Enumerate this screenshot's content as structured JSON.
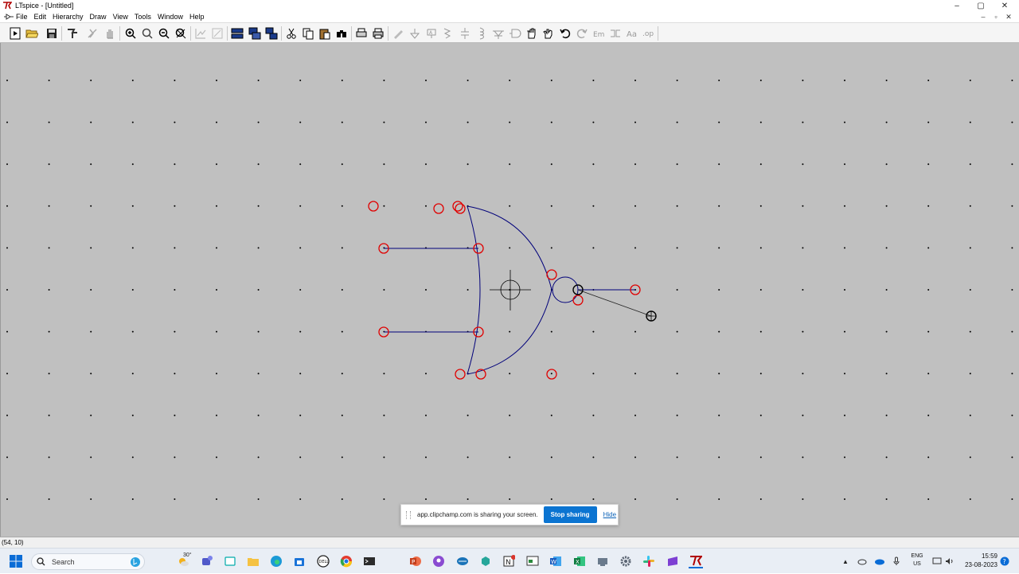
{
  "window": {
    "title": "LTspice - [Untitled]",
    "controls": [
      "–",
      "▢",
      "✕"
    ],
    "mdi_controls": [
      "–",
      "▫",
      "✕"
    ]
  },
  "menu": {
    "items": [
      "File",
      "Edit",
      "Hierarchy",
      "Draw",
      "View",
      "Tools",
      "Window",
      "Help"
    ]
  },
  "toolbar": {
    "buttons": [
      "new-schematic-icon",
      "open-icon",
      "save-icon",
      "control-panel-icon",
      "run-icon",
      "halt-icon",
      "zoom-in-icon",
      "zoom-pan-icon",
      "zoom-out-icon",
      "zoom-fit-icon",
      "autorange-icon",
      "probe-icon",
      "tile-horizontal-icon",
      "tile-vertical-icon",
      "cascade-icon",
      "cut-icon",
      "copy-icon",
      "paste-icon",
      "find-icon",
      "print-setup-icon",
      "print-icon",
      "wire-icon",
      "ground-icon",
      "label-icon",
      "resistor-icon",
      "capacitor-icon",
      "inductor-icon",
      "diode-icon",
      "component-icon",
      "move-icon",
      "drag-icon",
      "undo-icon",
      "redo-icon",
      "rotate-icon",
      "mirror-icon",
      "text-icon",
      "spice-directive-icon"
    ]
  },
  "colors": {
    "canvas_bg": "#c0c0c0",
    "grid_dot": "#000000",
    "wire": "#00007a",
    "pin_marker": "#e00000",
    "cursor": "#000000",
    "share_button": "#0b74d1"
  },
  "status": {
    "coordinates": "(54, 10)"
  },
  "share_notice": {
    "message": "app.clipchamp.com is sharing your screen.",
    "stop_label": "Stop sharing",
    "hide_label": "Hide"
  },
  "taskbar": {
    "search_placeholder": "Search",
    "weather": "30°",
    "apps": [
      "widgets-icon",
      "teams-icon",
      "taskview-icon",
      "file-explorer-icon",
      "edge-icon",
      "store-icon",
      "dell-icon",
      "chrome-icon",
      "terminal-icon",
      "powerpoint-icon",
      "podcast-icon",
      "photos-icon",
      "browser-icon",
      "onenote-icon",
      "whiteboard-icon",
      "word-icon",
      "excel-icon",
      "remote-icon",
      "settings-icon",
      "slack-icon",
      "clipchamp-icon",
      "ltspice-icon"
    ],
    "lang_line1": "ENG",
    "lang_line2": "US",
    "time": "15:59",
    "date": "23-08-2023"
  }
}
